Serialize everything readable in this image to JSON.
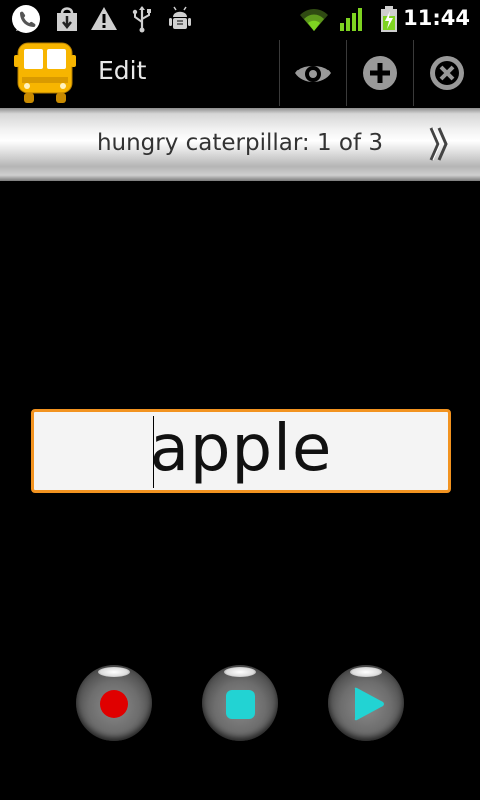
{
  "status_bar": {
    "time": "11:44",
    "icons": [
      "phone-chat-icon",
      "download-icon",
      "warning-icon",
      "usb-icon",
      "android-debug-icon",
      "wifi-icon",
      "signal-icon",
      "battery-charging-icon"
    ]
  },
  "action_bar": {
    "title": "Edit",
    "logo_icon": "bus-icon",
    "actions": [
      {
        "name": "view",
        "icon": "eye-icon"
      },
      {
        "name": "add",
        "icon": "plus-circle-icon"
      },
      {
        "name": "close",
        "icon": "close-circle-icon"
      }
    ]
  },
  "banner": {
    "text": "hungry caterpillar: 1 of 3",
    "next_icon": "fast-forward-icon"
  },
  "word_card": {
    "word": "apple"
  },
  "controls": [
    {
      "name": "record",
      "icon": "record-icon",
      "color": "#e00000"
    },
    {
      "name": "stop",
      "icon": "stop-icon",
      "color": "#22d3d3"
    },
    {
      "name": "play",
      "icon": "play-icon",
      "color": "#22d3d3"
    }
  ],
  "colors": {
    "accent_orange": "#f29320",
    "logo_yellow": "#f7b500",
    "wifi_green": "#7ed321"
  }
}
